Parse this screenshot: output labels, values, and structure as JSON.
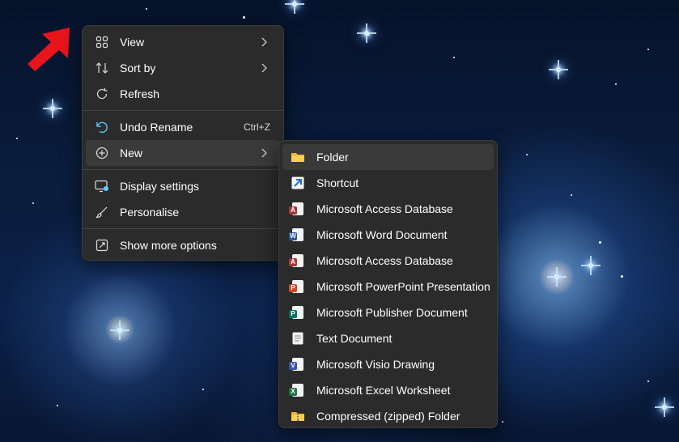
{
  "main_menu": {
    "items": [
      {
        "label": "View",
        "icon": "grid-icon"
      },
      {
        "label": "Sort by",
        "icon": "sort-icon"
      },
      {
        "label": "Refresh",
        "icon": "refresh-icon"
      },
      {
        "label": "Undo Rename",
        "icon": "undo-icon",
        "shortcut": "Ctrl+Z"
      },
      {
        "label": "New",
        "icon": "plus-circle-icon"
      },
      {
        "label": "Display settings",
        "icon": "display-icon"
      },
      {
        "label": "Personalise",
        "icon": "brush-icon"
      },
      {
        "label": "Show more options",
        "icon": "show-more-icon"
      }
    ]
  },
  "new_submenu": {
    "items": [
      {
        "label": "Folder",
        "icon": "folder-icon"
      },
      {
        "label": "Shortcut",
        "icon": "shortcut-icon"
      },
      {
        "label": "Microsoft Access Database",
        "icon": "access-icon"
      },
      {
        "label": "Microsoft Word Document",
        "icon": "word-icon"
      },
      {
        "label": "Microsoft Access Database",
        "icon": "access-icon"
      },
      {
        "label": "Microsoft PowerPoint Presentation",
        "icon": "powerpoint-icon"
      },
      {
        "label": "Microsoft Publisher Document",
        "icon": "publisher-icon"
      },
      {
        "label": "Text Document",
        "icon": "text-document-icon"
      },
      {
        "label": "Microsoft Visio Drawing",
        "icon": "visio-icon"
      },
      {
        "label": "Microsoft Excel Worksheet",
        "icon": "excel-icon"
      },
      {
        "label": "Compressed (zipped) Folder",
        "icon": "zip-folder-icon"
      }
    ]
  },
  "colors": {
    "menu_bg": "#2b2b2b",
    "highlight": "#3a3a3a",
    "text": "#ffffff",
    "arrow": "#e8141c",
    "accent_icon": "#60cdff"
  }
}
